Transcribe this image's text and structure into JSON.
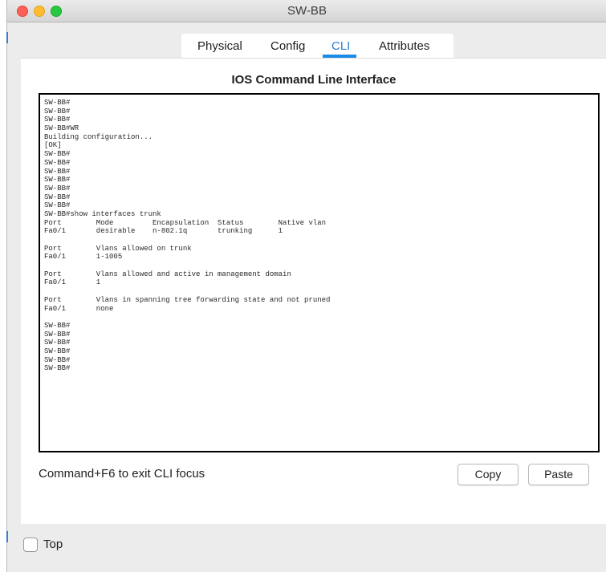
{
  "window": {
    "title": "SW-BB"
  },
  "tabs": [
    {
      "label": "Physical",
      "active": false
    },
    {
      "label": "Config",
      "active": false
    },
    {
      "label": "CLI",
      "active": true
    },
    {
      "label": "Attributes",
      "active": false
    }
  ],
  "cli": {
    "heading": "IOS Command Line Interface",
    "lines": [
      "SW-BB#",
      "SW-BB#",
      "SW-BB#",
      "SW-BB#WR",
      "Building configuration...",
      "[OK]",
      "SW-BB#",
      "SW-BB#",
      "SW-BB#",
      "SW-BB#",
      "SW-BB#",
      "SW-BB#",
      "SW-BB#",
      "SW-BB#show interfaces trunk",
      "Port        Mode         Encapsulation  Status        Native vlan",
      "Fa0/1       desirable    n-802.1q       trunking      1",
      "",
      "Port        Vlans allowed on trunk",
      "Fa0/1       1-1005",
      "",
      "Port        Vlans allowed and active in management domain",
      "Fa0/1       1",
      "",
      "Port        Vlans in spanning tree forwarding state and not pruned",
      "Fa0/1       none",
      "",
      "SW-BB#",
      "SW-BB#",
      "SW-BB#",
      "SW-BB#",
      "SW-BB#",
      "SW-BB#"
    ],
    "hint": "Command+F6 to exit CLI focus",
    "copy_label": "Copy",
    "paste_label": "Paste"
  },
  "footer": {
    "top_label": "Top",
    "top_checked": false
  },
  "colors": {
    "accent": "#1a8be6",
    "active_tab_text": "#2b7fd4"
  }
}
